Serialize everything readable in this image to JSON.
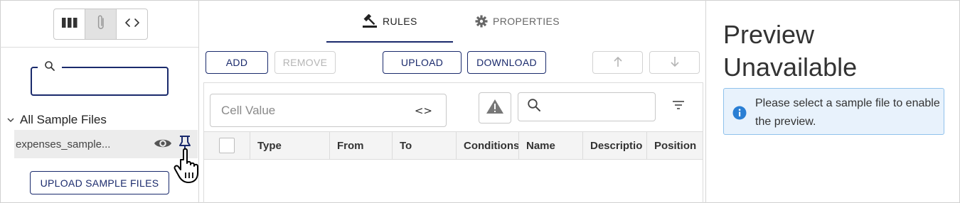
{
  "left_panel": {
    "view_toggle": {
      "options": [
        "columns-icon",
        "paperclip-icon",
        "code-icon"
      ],
      "active": "paperclip-icon"
    },
    "search": {
      "placeholder": ""
    },
    "tree": {
      "header": "All Sample Files",
      "files": [
        {
          "name": "expenses_sample..."
        }
      ]
    },
    "upload_sample_label": "UPLOAD SAMPLE FILES"
  },
  "center_panel": {
    "tabs": [
      {
        "label": "RULES",
        "active": true,
        "icon": "gavel-icon"
      },
      {
        "label": "PROPERTIES",
        "active": false,
        "icon": "gear-icon"
      }
    ],
    "toolbar": {
      "add_label": "ADD",
      "remove_label": "REMOVE",
      "upload_label": "UPLOAD",
      "download_label": "DOWNLOAD"
    },
    "cell_value": {
      "placeholder": "Cell Value",
      "code_symbol": "<>"
    },
    "grid": {
      "columns": [
        "Type",
        "From",
        "To",
        "Conditions",
        "Name",
        "Descriptio",
        "Position"
      ],
      "rows": []
    }
  },
  "right_panel": {
    "title": "Preview Unavailable",
    "info_message": "Please select a sample file to enable the preview."
  },
  "colors": {
    "accent": "#1a2a6c",
    "info_bg": "#e8f2fc",
    "info_border": "#90c2ec",
    "info_icon": "#2a7fd4"
  }
}
